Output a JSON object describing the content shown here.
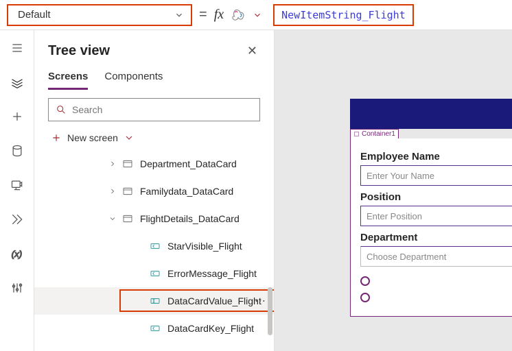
{
  "formula_bar": {
    "property": "Default",
    "value": "NewItemString_Flight"
  },
  "tree": {
    "title": "Tree view",
    "tabs": {
      "screens": "Screens",
      "components": "Components"
    },
    "search_placeholder": "Search",
    "new_screen": "New screen",
    "nodes": {
      "dept": "Department_DataCard",
      "family": "Familydata_DataCard",
      "flight": "FlightDetails_DataCard",
      "star": "StarVisible_Flight",
      "err": "ErrorMessage_Flight",
      "dcv": "DataCardValue_Flight",
      "dck": "DataCardKey_Flight"
    }
  },
  "canvas": {
    "container_label": "Container1",
    "fields": {
      "emp_label": "Employee Name",
      "emp_placeholder": "Enter Your Name",
      "pos_label": "Position",
      "pos_placeholder": "Enter Position",
      "dept_label": "Department",
      "dept_placeholder": "Choose Department"
    }
  }
}
